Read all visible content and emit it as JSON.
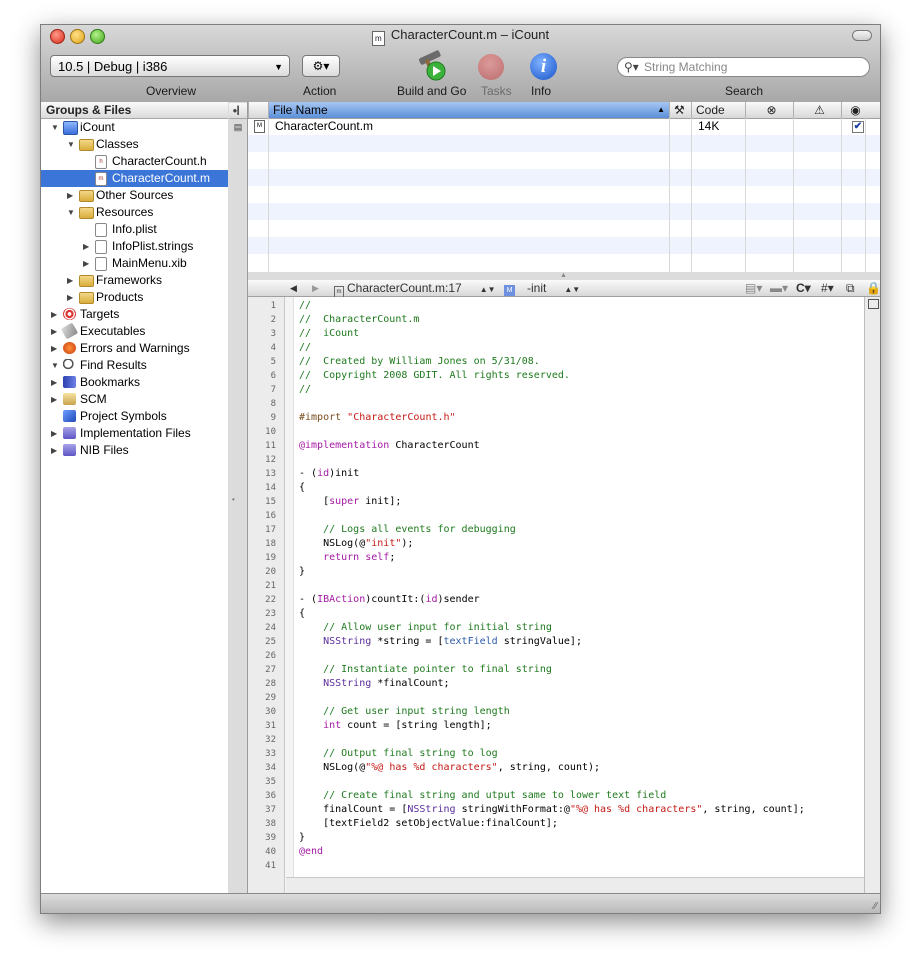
{
  "window": {
    "title": "CharacterCount.m – iCount",
    "title_icon": "m"
  },
  "toolbar": {
    "overview_value": "10.5 | Debug | i386",
    "overview_label": "Overview",
    "action_label": "Action",
    "build_label": "Build and Go",
    "tasks_label": "Tasks",
    "info_label": "Info",
    "search_placeholder": "String Matching",
    "search_label": "Search"
  },
  "sidebar": {
    "header": "Groups & Files",
    "items": [
      {
        "label": "iCount",
        "indent": 0,
        "triangle": "down",
        "icon": "blue",
        "icon_name": "project-icon"
      },
      {
        "label": "Classes",
        "indent": 1,
        "triangle": "down",
        "icon": "folder",
        "icon_name": "folder-icon"
      },
      {
        "label": "CharacterCount.h",
        "indent": 2,
        "triangle": "",
        "icon": "doc",
        "icon_name": "header-file-icon",
        "doc_letter": "h"
      },
      {
        "label": "CharacterCount.m",
        "indent": 2,
        "triangle": "",
        "icon": "doc",
        "icon_name": "source-file-icon",
        "doc_letter": "m",
        "selected": true
      },
      {
        "label": "Other Sources",
        "indent": 1,
        "triangle": "right",
        "icon": "folder",
        "icon_name": "folder-icon"
      },
      {
        "label": "Resources",
        "indent": 1,
        "triangle": "down",
        "icon": "folder",
        "icon_name": "folder-icon"
      },
      {
        "label": "Info.plist",
        "indent": 2,
        "triangle": "",
        "icon": "doc",
        "icon_name": "plist-file-icon",
        "doc_letter": ""
      },
      {
        "label": "InfoPlist.strings",
        "indent": 2,
        "triangle": "right",
        "icon": "doc",
        "icon_name": "strings-file-icon",
        "doc_letter": ""
      },
      {
        "label": "MainMenu.xib",
        "indent": 2,
        "triangle": "right",
        "icon": "doc",
        "icon_name": "xib-file-icon",
        "doc_letter": ""
      },
      {
        "label": "Frameworks",
        "indent": 1,
        "triangle": "right",
        "icon": "folder",
        "icon_name": "folder-icon"
      },
      {
        "label": "Products",
        "indent": 1,
        "triangle": "right",
        "icon": "folder",
        "icon_name": "folder-icon"
      },
      {
        "label": "Targets",
        "indent": 0,
        "triangle": "right",
        "icon": "target",
        "icon_name": "target-icon"
      },
      {
        "label": "Executables",
        "indent": 0,
        "triangle": "right",
        "icon": "exec",
        "icon_name": "executable-icon"
      },
      {
        "label": "Errors and Warnings",
        "indent": 0,
        "triangle": "right",
        "icon": "warn",
        "icon_name": "warning-icon"
      },
      {
        "label": "Find Results",
        "indent": 0,
        "triangle": "down",
        "icon": "find",
        "icon_name": "magnifier-icon"
      },
      {
        "label": "Bookmarks",
        "indent": 0,
        "triangle": "right",
        "icon": "book",
        "icon_name": "bookmark-icon"
      },
      {
        "label": "SCM",
        "indent": 0,
        "triangle": "right",
        "icon": "scm",
        "icon_name": "scm-icon"
      },
      {
        "label": "Project Symbols",
        "indent": 0,
        "triangle": "",
        "icon": "cube",
        "icon_name": "symbols-icon"
      },
      {
        "label": "Implementation Files",
        "indent": 0,
        "triangle": "right",
        "icon": "impl",
        "icon_name": "smart-group-icon"
      },
      {
        "label": "NIB Files",
        "indent": 0,
        "triangle": "right",
        "icon": "impl",
        "icon_name": "smart-group-icon"
      }
    ]
  },
  "file_table": {
    "columns": {
      "file_name": "File Name",
      "code": "Code"
    },
    "rows": [
      {
        "name": "CharacterCount.m",
        "code": "14K",
        "checked": true
      }
    ]
  },
  "editor": {
    "nav_file": "CharacterCount.m:17",
    "nav_symbol": "-init",
    "nav_symbol_badge": "M",
    "nav_right_c": "C",
    "nav_right_hash": "#",
    "lines": [
      [
        [
          "c",
          "//"
        ]
      ],
      [
        [
          "c",
          "//  CharacterCount.m"
        ]
      ],
      [
        [
          "c",
          "//  iCount"
        ]
      ],
      [
        [
          "c",
          "//"
        ]
      ],
      [
        [
          "c",
          "//  Created by William Jones on 5/31/08."
        ]
      ],
      [
        [
          "c",
          "//  Copyright 2008 GDIT. All rights reserved."
        ]
      ],
      [
        [
          "c",
          "//"
        ]
      ],
      [],
      [
        [
          "p",
          "#import "
        ],
        [
          "s",
          "\"CharacterCount.h\""
        ]
      ],
      [],
      [
        [
          "k",
          "@implementation"
        ],
        [
          "n",
          " CharacterCount"
        ]
      ],
      [],
      [
        [
          "n",
          "- ("
        ],
        [
          "k",
          "id"
        ],
        [
          "n",
          ")init"
        ]
      ],
      [
        [
          "n",
          "{"
        ]
      ],
      [
        [
          "n",
          "    ["
        ],
        [
          "k",
          "super"
        ],
        [
          "n",
          " init];"
        ]
      ],
      [],
      [
        [
          "c",
          "    // Logs all events for debugging"
        ]
      ],
      [
        [
          "n",
          "    NSLog(@"
        ],
        [
          "s",
          "\"init\""
        ],
        [
          "n",
          ");"
        ]
      ],
      [
        [
          "k",
          "    return"
        ],
        [
          "n",
          " "
        ],
        [
          "k",
          "self"
        ],
        [
          "n",
          ";"
        ]
      ],
      [
        [
          "n",
          "}"
        ]
      ],
      [],
      [
        [
          "n",
          "- ("
        ],
        [
          "k",
          "IBAction"
        ],
        [
          "n",
          ")countIt:("
        ],
        [
          "k",
          "id"
        ],
        [
          "n",
          ")sender"
        ]
      ],
      [
        [
          "n",
          "{"
        ]
      ],
      [
        [
          "c",
          "    // Allow user input for initial string"
        ]
      ],
      [
        [
          "t",
          "    NSString"
        ],
        [
          "n",
          " *string = ["
        ],
        [
          "i",
          "textField"
        ],
        [
          "n",
          " stringValue];"
        ]
      ],
      [],
      [
        [
          "c",
          "    // Instantiate pointer to final string"
        ]
      ],
      [
        [
          "t",
          "    NSString"
        ],
        [
          "n",
          " *finalCount;"
        ]
      ],
      [],
      [
        [
          "c",
          "    // Get user input string length"
        ]
      ],
      [
        [
          "k",
          "    int"
        ],
        [
          "n",
          " count = [string length];"
        ]
      ],
      [],
      [
        [
          "c",
          "    // Output final string to log"
        ]
      ],
      [
        [
          "n",
          "    NSLog(@"
        ],
        [
          "s",
          "\"%@ has %d characters\""
        ],
        [
          "n",
          ", string, count);"
        ]
      ],
      [],
      [
        [
          "c",
          "    // Create final string and utput same to lower text field"
        ]
      ],
      [
        [
          "n",
          "    finalCount = ["
        ],
        [
          "t",
          "NSString"
        ],
        [
          "n",
          " stringWithFormat:@"
        ],
        [
          "s",
          "\"%@ has %d characters\""
        ],
        [
          "n",
          ", string, count];"
        ]
      ],
      [
        [
          "n",
          "    [textField2 setObjectValue:finalCount];"
        ]
      ],
      [
        [
          "n",
          "}"
        ]
      ],
      [
        [
          "k",
          "@end"
        ]
      ],
      []
    ]
  },
  "colors": {
    "selection": "#3a75d7",
    "comment": "#1e7a1e",
    "keyword": "#a31aa3",
    "string": "#c41a16"
  }
}
